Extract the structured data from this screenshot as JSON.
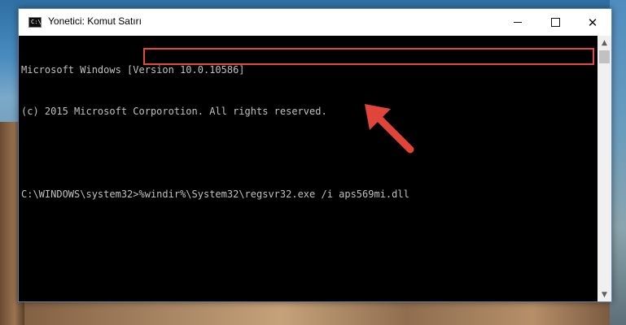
{
  "window": {
    "title": "Yonetici: Komut Satırı",
    "icon_label": "C:\\_",
    "controls": {
      "minimize": "minimize-icon",
      "maximize": "maximize-icon",
      "close": "✕"
    }
  },
  "console": {
    "lines": [
      "Microsoft Windows [Version 10.0.10586]",
      "(c) 2015 Microsoft Corporotion. All rights reserved."
    ],
    "prompt": "C:\\WINDOWS\\system32>",
    "command": "%windir%\\System32\\regsvr32.exe /i aps569mi.dll"
  },
  "scrollbar": {
    "up": "▲",
    "down": "▼"
  },
  "colors": {
    "highlight": "#e64a3c",
    "arrow": "#e0453a",
    "console_bg": "#000000",
    "console_text": "#c0c0c0"
  }
}
